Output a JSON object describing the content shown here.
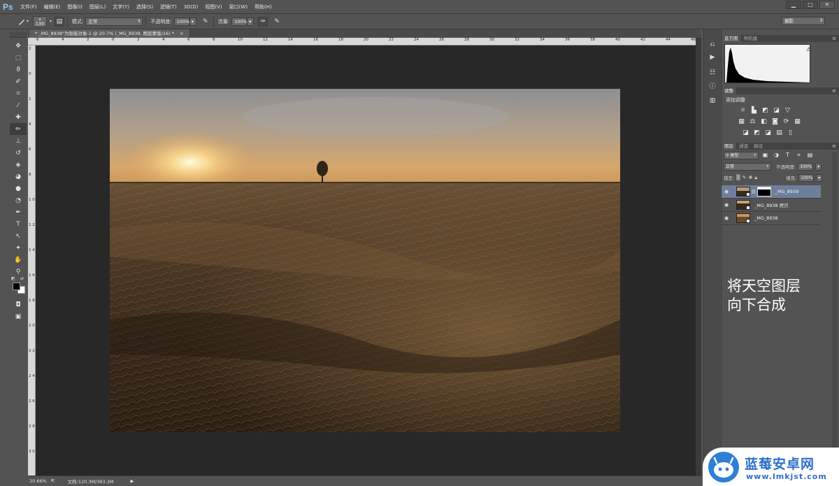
{
  "app": {
    "logo": "Ps"
  },
  "menu": [
    "文件(F)",
    "编辑(E)",
    "图像(I)",
    "图层(L)",
    "文字(Y)",
    "选择(S)",
    "滤镜(T)",
    "3D(D)",
    "视图(V)",
    "窗口(W)",
    "帮助(H)"
  ],
  "window_controls": {
    "minimize": "▁",
    "maximize": "□",
    "close": "✕"
  },
  "options": {
    "brush_size": "130",
    "mode_label": "模式:",
    "mode_value": "正常",
    "opacity_label": "不透明度:",
    "opacity_value": "100%",
    "flow_label": "流量:",
    "flow_value": "100%",
    "workspace": "摄影"
  },
  "document": {
    "tab_title": "* _MG_8938\"为智能对象-1 @ 20.7% (_MG_8939, 图层蒙版/16) *",
    "close": "×"
  },
  "ruler": {
    "top": [
      "6",
      "4",
      "2",
      "0",
      "2",
      "4",
      "6",
      "8",
      "10",
      "12",
      "14",
      "16",
      "18",
      "20",
      "22",
      "24",
      "26",
      "28",
      "30",
      "32",
      "34",
      "36",
      "38",
      "40",
      "42",
      "44",
      "46"
    ],
    "left": [
      "2",
      "0",
      "2",
      "4",
      "6",
      "8",
      "1 0",
      "1 2",
      "1 4",
      "1 6",
      "1 8",
      "2 0",
      "2 2",
      "2 4",
      "2 6",
      "2 8",
      "3 0"
    ]
  },
  "status": {
    "zoom": "20.66%",
    "doc_info": "文档:120.3M/393.3M",
    "arrow": "▶"
  },
  "panels": {
    "histogram_tabs": [
      "直方图",
      "导航器"
    ],
    "warning": "⚠",
    "adjustments_tab": "调整",
    "adjustments_title": "添加调整",
    "layers_tabs": [
      "图层",
      "通道",
      "路径"
    ],
    "filter_kind": "类型",
    "blend_mode": "正常",
    "opacity_label": "不透明度:",
    "opacity_value": "100%",
    "lock_label": "锁定:",
    "fill_label": "填充:",
    "fill_value": "100%",
    "layers": [
      {
        "name": "_MG_8939",
        "selected": true,
        "has_mask": true
      },
      {
        "name": "_MG_8938 拷贝",
        "selected": false,
        "has_mask": false
      },
      {
        "name": "_MG_8938",
        "selected": false,
        "has_mask": false
      }
    ]
  },
  "caption": {
    "line1": "将天空图层",
    "line2": "向下合成"
  },
  "watermark": {
    "title": "蓝莓安卓网",
    "url": "www.lmkjst.com"
  },
  "colors": {
    "panel": "#535353",
    "canvas": "#282828",
    "selected_layer": "#6d7f9a",
    "accent": "#2f7fd6"
  }
}
